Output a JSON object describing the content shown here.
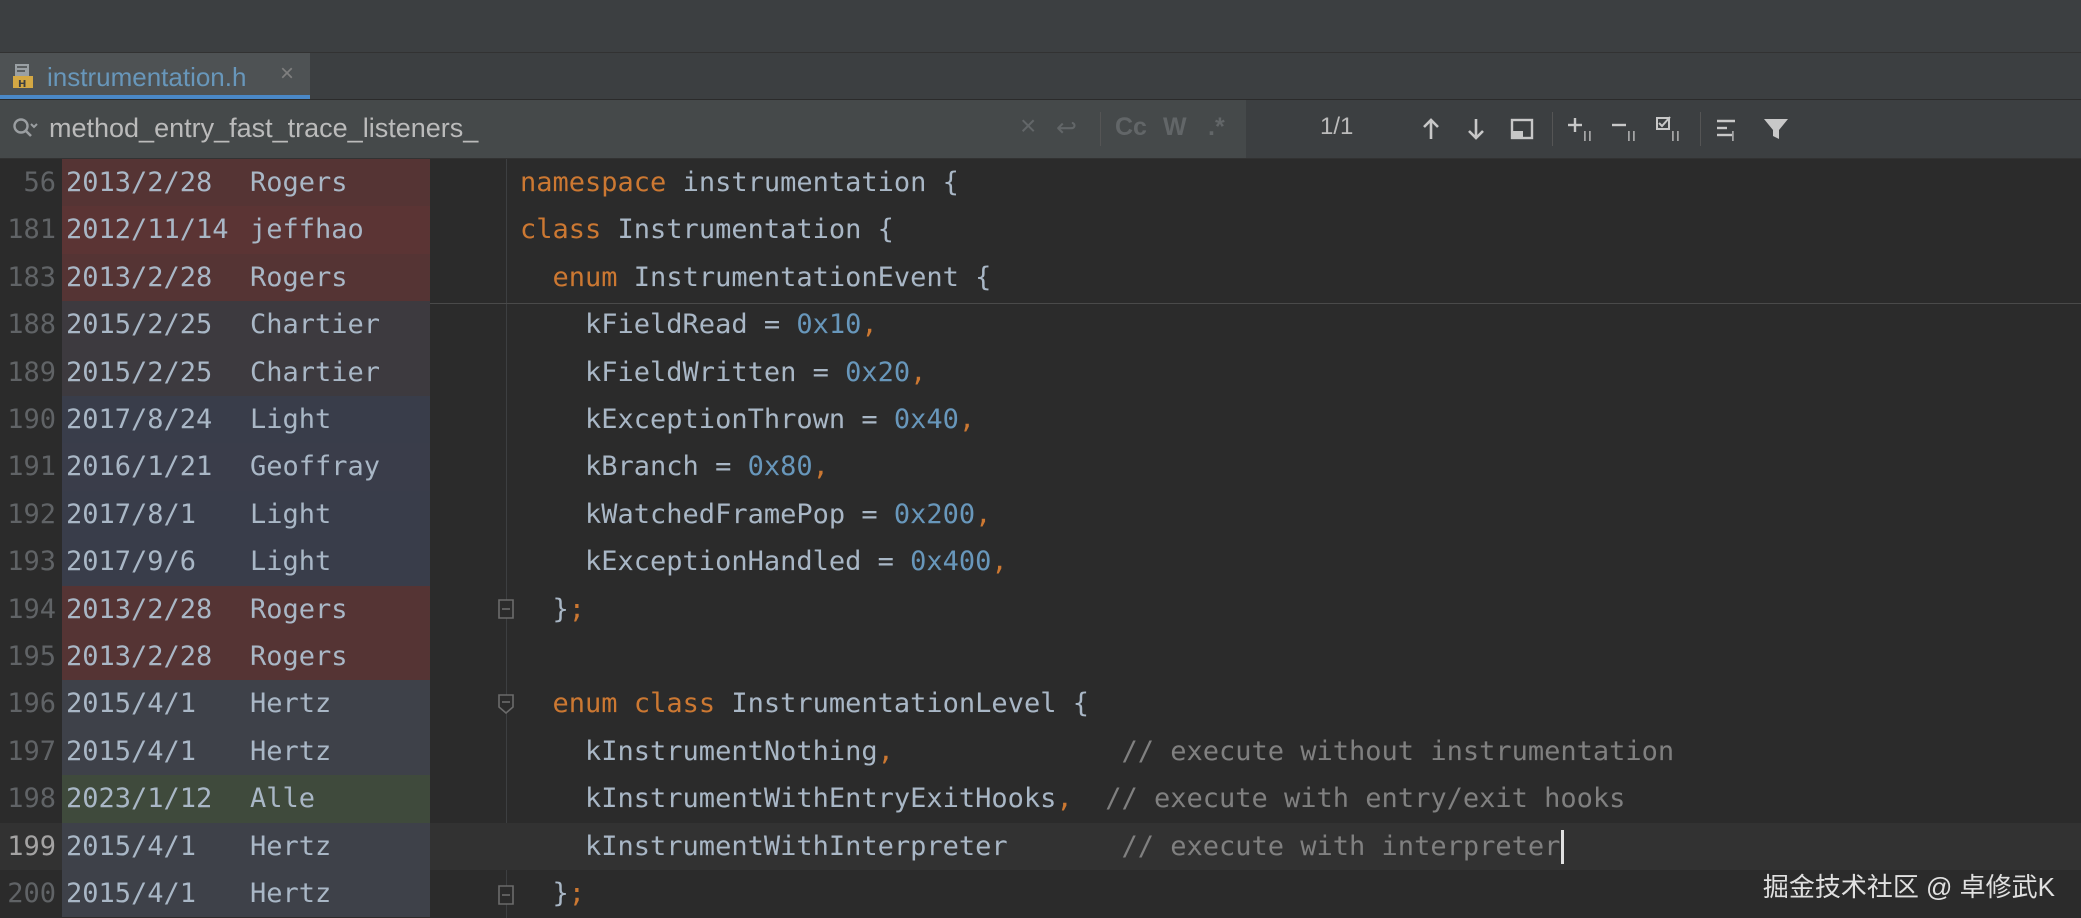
{
  "tab": {
    "filename": "instrumentation.h",
    "close": "×",
    "icon": "h-file-icon"
  },
  "find": {
    "query": "method_entry_fast_trace_listeners_",
    "clear": "×",
    "newline": "↩",
    "match_case": "Cc",
    "words": "W",
    "regex": ".*",
    "count": "1/1"
  },
  "colors": {
    "rogers": "#553434",
    "chartier": "#3d3a3f",
    "light": "#393d4a",
    "geoffray": "#3a3d4a",
    "jeffhao": "#5b3434",
    "hertz": "#3e4149",
    "alle": "#3f4a3c"
  },
  "lines": [
    {
      "num": "56",
      "date": "2013/2/28",
      "author": "Rogers"
    },
    {
      "num": "181",
      "date": "2012/11/14",
      "author": "jeffhao"
    },
    {
      "num": "183",
      "date": "2013/2/28",
      "author": "Rogers"
    },
    {
      "num": "188",
      "date": "2015/2/25",
      "author": "Chartier"
    },
    {
      "num": "189",
      "date": "2015/2/25",
      "author": "Chartier"
    },
    {
      "num": "190",
      "date": "2017/8/24",
      "author": "Light"
    },
    {
      "num": "191",
      "date": "2016/1/21",
      "author": "Geoffray"
    },
    {
      "num": "192",
      "date": "2017/8/1",
      "author": "Light"
    },
    {
      "num": "193",
      "date": "2017/9/6",
      "author": "Light"
    },
    {
      "num": "194",
      "date": "2013/2/28",
      "author": "Rogers"
    },
    {
      "num": "195",
      "date": "2013/2/28",
      "author": "Rogers"
    },
    {
      "num": "196",
      "date": "2015/4/1",
      "author": "Hertz"
    },
    {
      "num": "197",
      "date": "2015/4/1",
      "author": "Hertz"
    },
    {
      "num": "198",
      "date": "2023/1/12",
      "author": "Alle"
    },
    {
      "num": "199",
      "date": "2015/4/1",
      "author": "Hertz"
    },
    {
      "num": "200",
      "date": "2015/4/1",
      "author": "Hertz"
    }
  ],
  "code": {
    "l56_kw": "namespace",
    "l56_rest": " instrumentation {",
    "l181_kw": "class",
    "l181_rest": " Instrumentation {",
    "l183_indent": "  ",
    "l183_kw": "enum",
    "l183_rest": " InstrumentationEvent {",
    "l188_name": "    kFieldRead = ",
    "l188_num": "0x10",
    "l188_comma": ",",
    "l189_name": "    kFieldWritten = ",
    "l189_num": "0x20",
    "l189_comma": ",",
    "l190_name": "    kExceptionThrown = ",
    "l190_num": "0x40",
    "l190_comma": ",",
    "l191_name": "    kBranch = ",
    "l191_num": "0x80",
    "l191_comma": ",",
    "l192_name": "    kWatchedFramePop = ",
    "l192_num": "0x200",
    "l192_comma": ",",
    "l193_name": "    kExceptionHandled = ",
    "l193_num": "0x400",
    "l193_comma": ",",
    "l194_brace": "  }",
    "l194_semi": ";",
    "l196_indent": "  ",
    "l196_kw1": "enum",
    "l196_sp": " ",
    "l196_kw2": "class",
    "l196_rest": " InstrumentationLevel {",
    "l197_name": "    kInstrumentNothing",
    "l197_comma": ",",
    "l197_pad": "              ",
    "l197_cmt": "// execute without instrumentation",
    "l198_name": "    kInstrumentWithEntryExitHooks",
    "l198_comma": ",",
    "l198_pad": "  ",
    "l198_cmt": "// execute with entry/exit hooks",
    "l199_name": "    kInstrumentWithInterpreter",
    "l199_pad": "       ",
    "l199_cmt": "// execute with interpreter",
    "l200_brace": "  }",
    "l200_semi": ";"
  },
  "watermark": "掘金技术社区 @ 卓修武K"
}
